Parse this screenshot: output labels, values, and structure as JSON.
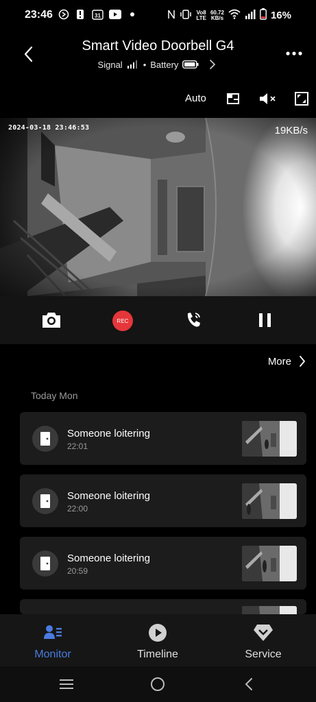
{
  "status_bar": {
    "time": "23:46",
    "net_speed_value": "60.72",
    "net_speed_unit": "KB/s",
    "calendar_day": "31",
    "battery_percent": "16%",
    "network_tag_top": "Vo8",
    "network_tag_bottom": "LTE"
  },
  "header": {
    "title": "Smart Video Doorbell G4",
    "signal_label": "Signal",
    "battery_label": "Battery",
    "separator": "•"
  },
  "toolbar": {
    "quality_label": "Auto"
  },
  "video": {
    "timestamp": "2024-03-18 23:46:53",
    "bitrate": "19KB/s"
  },
  "controls": {
    "rec_label": "REC"
  },
  "list": {
    "more_label": "More",
    "section_label": "Today Mon",
    "events": [
      {
        "title": "Someone loitering",
        "time": "22:01"
      },
      {
        "title": "Someone loitering",
        "time": "22:00"
      },
      {
        "title": "Someone loitering",
        "time": "20:59"
      }
    ]
  },
  "bottom_nav": {
    "items": [
      {
        "label": "Monitor",
        "icon": "monitor-icon",
        "active": true
      },
      {
        "label": "Timeline",
        "icon": "play-circle-icon",
        "active": false
      },
      {
        "label": "Service",
        "icon": "diamond-icon",
        "active": false
      }
    ]
  },
  "colors": {
    "accent": "#4a7be0",
    "rec_red": "#e5363a",
    "background": "#000000",
    "card": "#1c1c1c"
  }
}
